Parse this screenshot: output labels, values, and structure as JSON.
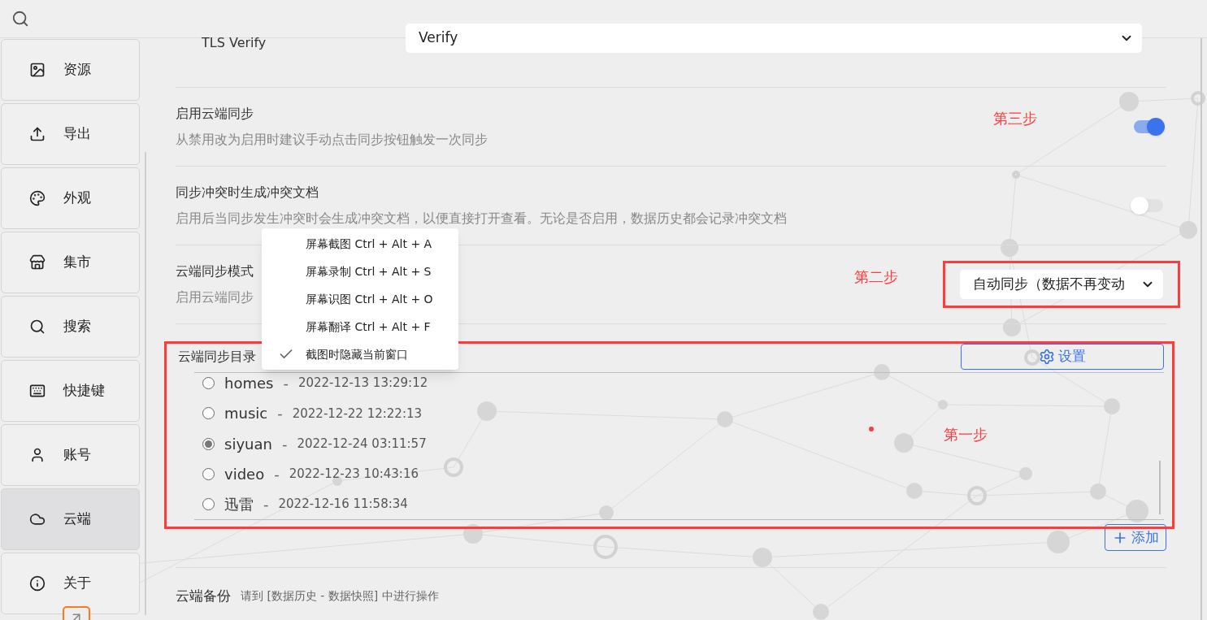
{
  "sidebar": {
    "items": [
      {
        "label": "资源",
        "kind": "image",
        "selected": false
      },
      {
        "label": "导出",
        "kind": "upload",
        "selected": false
      },
      {
        "label": "外观",
        "kind": "palette",
        "selected": false
      },
      {
        "label": "集市",
        "kind": "store",
        "selected": false
      },
      {
        "label": "搜索",
        "kind": "search",
        "selected": false
      },
      {
        "label": "快捷键",
        "kind": "keyboard",
        "selected": false
      },
      {
        "label": "账号",
        "kind": "user",
        "selected": false
      },
      {
        "label": "云端",
        "kind": "cloud",
        "selected": true
      },
      {
        "label": "关于",
        "kind": "info",
        "selected": false
      }
    ]
  },
  "settings": [
    {
      "kind": "select",
      "label": "TLS Verify",
      "value": "Verify"
    },
    {
      "kind": "switch",
      "label": "启用云端同步",
      "description": "从禁用改为启用时建议手动点击同步按钮触发一次同步",
      "on": true,
      "annotation": "第三步"
    },
    {
      "kind": "switch",
      "label": "同步冲突时生成冲突文档",
      "description": "启用后当同步发生冲突时会生成冲突文档，以便直接打开查看。无论是否启用，数据历史都会记录冲突文档",
      "on": false
    },
    {
      "kind": "select",
      "label": "云端同步模式",
      "description": "启用云端同步",
      "value": "自动同步（数据不再变动",
      "annotation": "第二步",
      "highlighted": true
    }
  ],
  "sync_directory": {
    "label": "云端同步目录",
    "button": "设置",
    "annotation": "第一步",
    "highlighted": true,
    "items": [
      {
        "name": "homes",
        "separator": "-",
        "time": "2022-12-13 13:29:12",
        "selected": false
      },
      {
        "name": "music",
        "separator": "-",
        "time": "2022-12-22 12:22:13",
        "selected": false
      },
      {
        "name": "siyuan",
        "separator": "-",
        "time": "2022-12-24 03:11:57",
        "selected": true
      },
      {
        "name": "video",
        "separator": "-",
        "time": "2022-12-23 10:43:16",
        "selected": false
      },
      {
        "name": "迅雷",
        "separator": "-",
        "time": "2022-12-16 11:58:34",
        "selected": false
      }
    ],
    "add_button": "添加"
  },
  "backup": {
    "label": "云端备份",
    "note": "请到 [数据历史 - 数据快照] 中进行操作"
  },
  "context_menu": {
    "items": [
      {
        "label": "屏幕截图 Ctrl + Alt + A",
        "checked": false
      },
      {
        "label": "屏幕录制 Ctrl + Alt + S",
        "checked": false
      },
      {
        "label": "屏幕识图 Ctrl + Alt + O",
        "checked": false
      },
      {
        "label": "屏幕翻译 Ctrl + Alt + F",
        "checked": false
      },
      {
        "label": "截图时隐藏当前窗口",
        "checked": true
      }
    ]
  }
}
